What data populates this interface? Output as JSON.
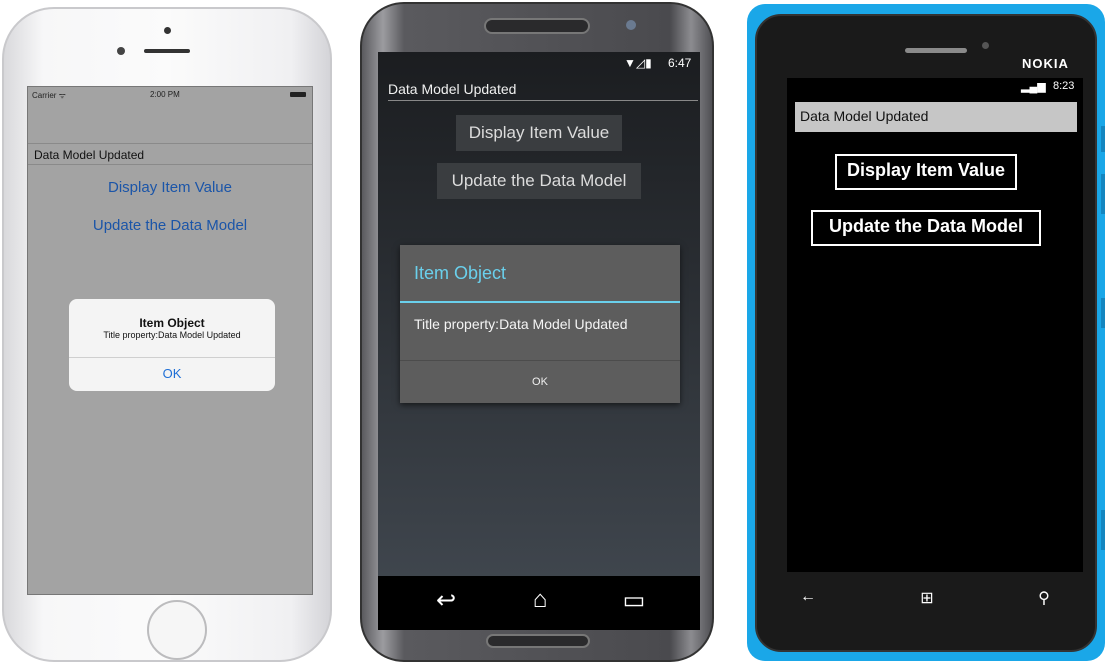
{
  "ios": {
    "status": {
      "carrier": "Carrier ᯤ",
      "time": "2:00 PM"
    },
    "label": "Data Model Updated",
    "display_button": "Display Item Value",
    "update_button": "Update the Data Model",
    "alert": {
      "title": "Item Object",
      "message": "Title property:Data Model Updated",
      "ok": "OK"
    }
  },
  "android": {
    "status": {
      "icons": "▼◿▮",
      "time": "6:47"
    },
    "label": "Data Model Updated",
    "display_button": "Display Item Value",
    "update_button": "Update the Data Model",
    "dialog": {
      "title": "Item Object",
      "message": "Title property:Data Model Updated",
      "ok": "OK"
    },
    "nav": {
      "back_glyph": "↩",
      "home_glyph": "⌂",
      "recents_glyph": "▭"
    }
  },
  "windows_phone": {
    "brand": "NOKIA",
    "status": {
      "signal": "▂▄▆",
      "time": "8:23"
    },
    "label": "Data Model Updated",
    "display_button": "Display Item Value",
    "update_button": "Update the Data Model",
    "nav": {
      "back_glyph": "←",
      "start_glyph": "⊞",
      "search_glyph": "⚲"
    }
  },
  "colors": {
    "ios_accent": "#1b55a8",
    "android_accent": "#6ad0ec",
    "wp_frame": "#1aa7e8"
  }
}
